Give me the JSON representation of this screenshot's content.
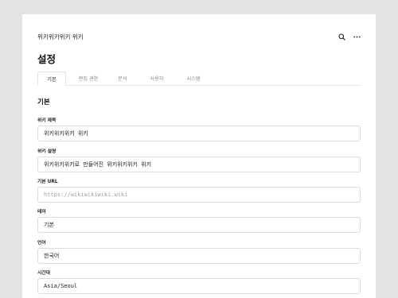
{
  "header": {
    "wiki_name": "위키위키위키 위키",
    "icons": [
      "search-icon",
      "more-icon"
    ]
  },
  "page": {
    "title": "설정"
  },
  "tabs": [
    {
      "label": "기본",
      "active": true
    },
    {
      "label": "편집 권한",
      "active": false
    },
    {
      "label": "문서",
      "active": false
    },
    {
      "label": "사용자",
      "active": false
    },
    {
      "label": "시스템",
      "active": false
    }
  ],
  "section": {
    "title": "기본"
  },
  "fields": {
    "wiki_title": {
      "label": "위키 제목",
      "value": "위키위키위키 위키"
    },
    "wiki_description": {
      "label": "위키 설명",
      "value": "위키위키위키로 만들어진 위키위키위키 위키"
    },
    "base_url": {
      "label": "기본 URL",
      "placeholder": "https://wikiwikiwiki.wiki"
    },
    "theme": {
      "label": "테마",
      "value": "기본"
    },
    "language": {
      "label": "언어",
      "value": "한국어"
    },
    "timezone": {
      "label": "시간대",
      "value": "Asia/Seoul"
    }
  },
  "colors": {
    "background": "#e3e3e3",
    "card": "#ffffff",
    "border": "#dcdcdc",
    "muted_text": "#888888"
  }
}
